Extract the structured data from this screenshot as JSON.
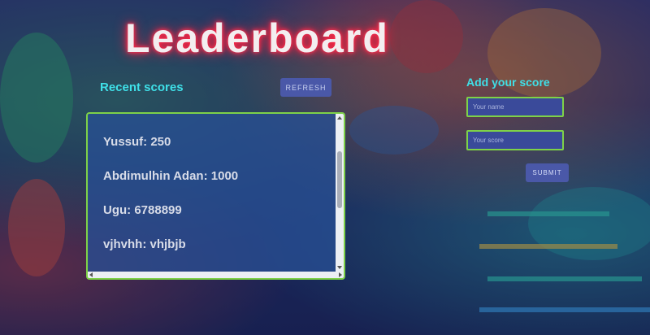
{
  "header": {
    "title": "Leaderboard"
  },
  "recent": {
    "heading": "Recent scores",
    "refresh_label": "REFRESH",
    "scores": [
      "Yussuf: 250",
      "Abdimulhin Adan: 1000",
      "Ugu: 6788899",
      "vjhvhh: vhjbjb"
    ]
  },
  "add": {
    "heading": "Add your score",
    "name_placeholder": "Your name",
    "score_placeholder": "Your score",
    "submit_label": "SUBMIT"
  },
  "colors": {
    "accent_cyan": "#3fe0e8",
    "border_green": "#7ed248",
    "button_bg": "#4a58a8",
    "title_glow": "#ff2040"
  }
}
